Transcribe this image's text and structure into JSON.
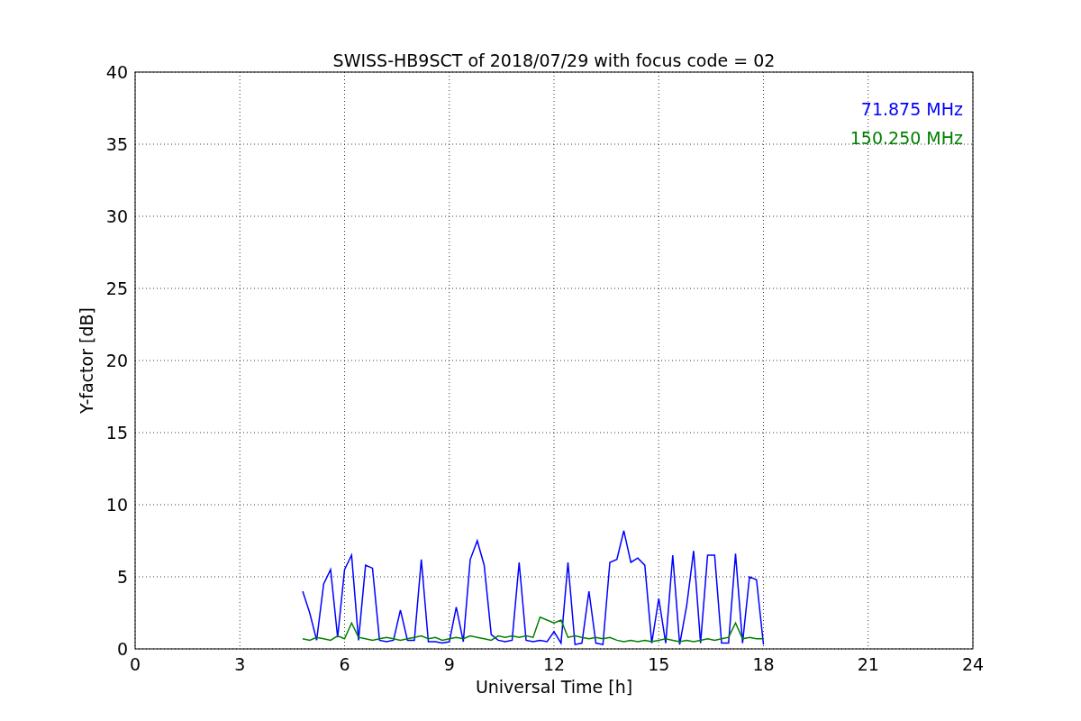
{
  "figure": {
    "chart_data": {
      "type": "line",
      "grid": true,
      "title": "SWISS-HB9SCT of 2018/07/29 with focus code = 02",
      "xlabel": "Universal Time [h]",
      "ylabel": "Y-factor [dB]",
      "xlim": [
        0,
        24
      ],
      "ylim": [
        0,
        40
      ],
      "xticks": [
        0,
        3,
        6,
        9,
        12,
        15,
        18,
        21,
        24
      ],
      "yticks": [
        0,
        5,
        10,
        15,
        20,
        25,
        30,
        35,
        40
      ],
      "x": [
        4.8,
        5.0,
        5.2,
        5.4,
        5.6,
        5.8,
        6.0,
        6.2,
        6.4,
        6.6,
        6.8,
        7.0,
        7.2,
        7.4,
        7.6,
        7.8,
        8.0,
        8.2,
        8.4,
        8.6,
        8.8,
        9.0,
        9.2,
        9.4,
        9.6,
        9.8,
        10.0,
        10.2,
        10.4,
        10.6,
        10.8,
        11.0,
        11.2,
        11.4,
        11.6,
        11.8,
        12.0,
        12.2,
        12.4,
        12.6,
        12.8,
        13.0,
        13.2,
        13.4,
        13.6,
        13.8,
        14.0,
        14.2,
        14.4,
        14.6,
        14.8,
        15.0,
        15.2,
        15.4,
        15.6,
        15.8,
        16.0,
        16.2,
        16.4,
        16.6,
        16.8,
        17.0,
        17.2,
        17.4,
        17.6,
        17.8,
        18.0
      ],
      "series": [
        {
          "name": "71.875 MHz",
          "color": "#0000ff",
          "values": [
            4.0,
            2.5,
            0.6,
            4.5,
            5.5,
            0.8,
            5.5,
            6.5,
            0.6,
            5.8,
            5.6,
            0.6,
            0.5,
            0.6,
            2.7,
            0.6,
            0.6,
            6.2,
            0.5,
            0.5,
            0.4,
            0.5,
            2.9,
            0.5,
            6.2,
            7.5,
            5.8,
            1.0,
            0.6,
            0.5,
            0.6,
            6.0,
            0.6,
            0.5,
            0.6,
            0.5,
            1.2,
            0.4,
            6.0,
            0.3,
            0.4,
            4.0,
            0.4,
            0.3,
            6.0,
            6.2,
            8.2,
            6.0,
            6.3,
            5.8,
            0.4,
            3.5,
            0.4,
            6.5,
            0.3,
            3.0,
            6.8,
            0.4,
            6.5,
            6.5,
            0.4,
            0.4,
            6.6,
            0.4,
            5.0,
            4.8,
            0.3
          ]
        },
        {
          "name": "150.250 MHz",
          "color": "#008000",
          "values": [
            0.7,
            0.6,
            0.8,
            0.7,
            0.6,
            0.9,
            0.7,
            1.8,
            0.8,
            0.7,
            0.6,
            0.7,
            0.8,
            0.7,
            0.6,
            0.7,
            0.8,
            0.9,
            0.7,
            0.8,
            0.6,
            0.7,
            0.8,
            0.7,
            0.9,
            0.8,
            0.7,
            0.6,
            0.9,
            0.8,
            0.9,
            0.8,
            0.9,
            0.8,
            2.2,
            2.0,
            1.8,
            2.0,
            0.8,
            0.9,
            0.8,
            0.7,
            0.8,
            0.7,
            0.8,
            0.6,
            0.5,
            0.6,
            0.5,
            0.6,
            0.5,
            0.6,
            0.7,
            0.6,
            0.5,
            0.6,
            0.5,
            0.6,
            0.7,
            0.6,
            0.7,
            0.8,
            1.8,
            0.7,
            0.8,
            0.7,
            0.7
          ]
        }
      ]
    }
  }
}
